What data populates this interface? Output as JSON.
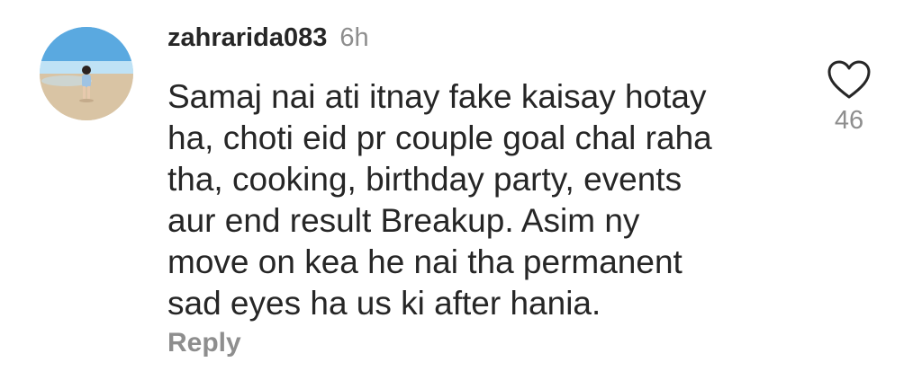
{
  "comment": {
    "username": "zahrarida083",
    "timestamp": "6h",
    "text": "Samaj nai ati itnay fake kaisay hotay\nha, choti eid pr couple goal chal raha\ntha, cooking, birthday party, events\naur end result Breakup. Asim ny\nmove on kea he nai tha permanent\nsad eyes ha us ki  after hania.",
    "reply_label": "Reply",
    "like_count": "46",
    "like_icon": "heart-outline-icon"
  },
  "colors": {
    "text": "#262626",
    "secondary": "#8e8e8e",
    "background": "#ffffff"
  }
}
